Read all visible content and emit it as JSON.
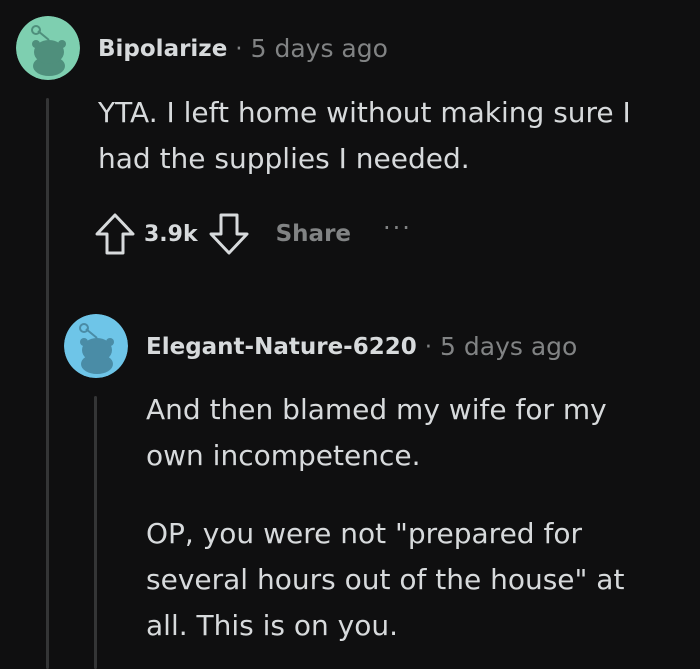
{
  "comment1": {
    "author": "Bipolarize",
    "separator": "·",
    "time": "5 days ago",
    "body": [
      "YTA. I left home without making sure I had the supplies I needed."
    ],
    "score": "3.9k",
    "share_label": "Share",
    "more_label": "···",
    "avatar_color": "#7ecfb0"
  },
  "comment2": {
    "author": "Elegant-Nature-6220",
    "separator": "·",
    "time": "5 days ago",
    "body": [
      "And then blamed my wife for my own incompetence.",
      "OP, you were not \"prepared for several hours out of the house\" at all. This is on you."
    ],
    "avatar_color": "#6ec5e8"
  }
}
